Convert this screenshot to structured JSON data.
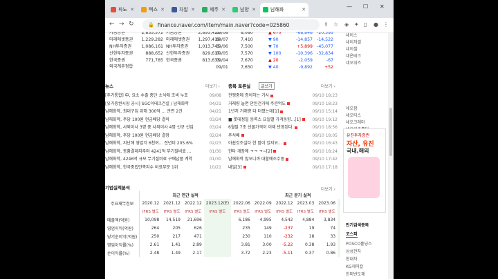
{
  "browser": {
    "tabs": [
      {
        "label": "파노",
        "color": "#e74c3c"
      },
      {
        "label": "텍스",
        "color": "#f39c12"
      },
      {
        "label": "차알",
        "color": "#3b5998"
      },
      {
        "label": "제주",
        "color": "#27ae60"
      },
      {
        "label": "남양",
        "color": "#2ecc71"
      },
      {
        "label": "남해화",
        "color": "#03c75a"
      }
    ],
    "url": "finance.naver.com/item/main.naver?code=025860"
  },
  "brokers": [
    {
      "a": "키움증권",
      "b": "2,835,572",
      "c": "키움증권",
      "d": "2,893,425"
    },
    {
      "a": "미래에셋증권",
      "b": "1,229,282",
      "c": "미래에셋증권",
      "d": "1,297,419"
    },
    {
      "a": "NH투자증권",
      "b": "1,086,161",
      "c": "NH투자증권",
      "d": "1,013,745"
    },
    {
      "a": "신한투자증권",
      "b": "888,652",
      "c": "신한투자증권",
      "d": "829,617"
    },
    {
      "a": "한국증권",
      "b": "771,785",
      "c": "한국증권",
      "d": "813,633"
    }
  ],
  "foreign_label": "외국계추정합",
  "daily": [
    {
      "date": "09/08",
      "price": "8,080",
      "chg": "▲ 670",
      "dir": "up",
      "vol": "-68,846",
      "inst": "-20,395"
    },
    {
      "date": "09/07",
      "price": "7,410",
      "chg": "▼ 90",
      "dir": "dn",
      "vol": "-14,857",
      "inst": "-14,522"
    },
    {
      "date": "09/06",
      "price": "7,500",
      "chg": "▼ 70",
      "dir": "dn",
      "vol": "+5,899",
      "inst": "-45,077"
    },
    {
      "date": "09/05",
      "price": "7,570",
      "chg": "▼ 100",
      "dir": "dn",
      "vol": "-10,396",
      "inst": "-32,834"
    },
    {
      "date": "09/04",
      "price": "7,670",
      "chg": "▲ 20",
      "dir": "up",
      "vol": "-2,059",
      "inst": "-67"
    },
    {
      "date": "09/01",
      "price": "7,650",
      "chg": "▼ 40",
      "dir": "dn",
      "vol": "-9,892",
      "inst": "+52"
    }
  ],
  "news_title": "뉴스",
  "more": "더보기",
  "news": [
    {
      "t": "[주가통합] 中, 요소 수출 중단 소식에 조비 누포",
      "d": "09/08"
    },
    {
      "t": "[유가증권시장 공시] SGC이테크건설 / 남해화학",
      "d": "04/21"
    },
    {
      "t": "남해화학, 최대구입 위해 300억 ... 관련 2건",
      "d": "04/21"
    },
    {
      "t": "남해화학, 주당 100원 현금배당 결의",
      "d": "03/24"
    },
    {
      "t": "남해화학, 사외이사 3명 중 사외이사 4명 신규 선임",
      "d": "03/24"
    },
    {
      "t": "남해화학, 주당 100원 현금배당 결정",
      "d": "02/24"
    },
    {
      "t": "남해화학, 지난해 영업익 6천여... 전년비 205.6%",
      "d": "02/23"
    },
    {
      "t": "남해화학, 동황결제지주와 4241억 무기질비료 ...",
      "d": "01/30"
    },
    {
      "t": "남해화학, 4246억 규모 무기질비료 구매납품 계약",
      "d": "01/30"
    },
    {
      "t": "남해화학, 한국중립만족지수 비료부문 1위",
      "d": "10/21"
    }
  ],
  "board_title": "종목 토론실",
  "board_badge": "글쓰기",
  "board": [
    {
      "t": "전쟁중에 증어하는 기사",
      "d": "09/10 18:23"
    },
    {
      "t": "거래량 늘면 안된건가에 주린먹도",
      "d": "09/10 18:23"
    },
    {
      "t": "1년치 거래량 다 터졌는데[1]",
      "d": "09/10 15:14"
    },
    {
      "t": "■ 롯데정밀 등록스 요일별 가격동향...[1]",
      "d": "09/10 19:12"
    },
    {
      "t": "6월말 7초 선물가격이 이제 반영된다.",
      "d": "09/10 18:56"
    },
    {
      "t": "주식배",
      "d": "09/10 18:05"
    },
    {
      "t": "아쉽것조실타 한 많이 있지요...",
      "d": "09/10 16:43"
    },
    {
      "t": "한타 개장에 ㅋㅋ ㅋ~[2]",
      "d": "09/10 18:24"
    },
    {
      "t": "남해화학 많오니까 대할에조수중",
      "d": "09/10 17:42"
    },
    {
      "t": "내일[3]",
      "d": "09/10 17:18"
    }
  ],
  "fin_title": "기업실적분석",
  "fin": {
    "annual_label": "최근 연간 실적",
    "quarter_label": "최근 분기 실적",
    "col_label": "주요재무정보",
    "years": [
      "2020.12",
      "2021.12",
      "2022.12",
      "2023.12(E)"
    ],
    "quarters": [
      "2022.06",
      "2022.09",
      "2022.12",
      "2023.03",
      "2023.06",
      "2023.09(E)"
    ],
    "ifrs": "IFRS 별도",
    "rows": [
      {
        "name": "매출액(억원)",
        "vals": [
          "10,098",
          "14,519",
          "21,696",
          "",
          "6,186",
          "4,995",
          "4,542",
          "4,884",
          "3,834",
          ""
        ]
      },
      {
        "name": "영업이익(억원)",
        "vals": [
          "264",
          "205",
          "626",
          "",
          "235",
          "149",
          "-237",
          "19",
          "74",
          ""
        ]
      },
      {
        "name": "당기순이익(억원)",
        "vals": [
          "250",
          "217",
          "471",
          "",
          "230",
          "110",
          "-232",
          "18",
          "33",
          ""
        ]
      },
      {
        "name": "영업이익률(%)",
        "vals": [
          "2.61",
          "1.41",
          "2.89",
          "",
          "3.81",
          "3.00",
          "-5.22",
          "0.38",
          "1.93",
          ""
        ]
      },
      {
        "name": "순이익률(%)",
        "vals": [
          "2.48",
          "1.49",
          "2.17",
          "",
          "3.72",
          "2.23",
          "-5.11",
          "0.37",
          "0.86",
          ""
        ]
      }
    ]
  },
  "side": {
    "links": [
      "네이스",
      "네이처셀",
      "네이셀",
      "네온테크",
      "네오위즈",
      "네오팜",
      "네오티스",
      "네오크레마",
      "네오위즈홀딩",
      "네오퍼즈"
    ],
    "ad_lines": [
      "유진투자증권",
      "자산, 유진",
      "국내,해외"
    ],
    "rank_title": "인기검색종목",
    "rank_tab": "코스피",
    "rank": [
      "POSCO홀딩스",
      "삼성전자",
      "현대차",
      "KG케미칼",
      "한미반도체"
    ]
  }
}
